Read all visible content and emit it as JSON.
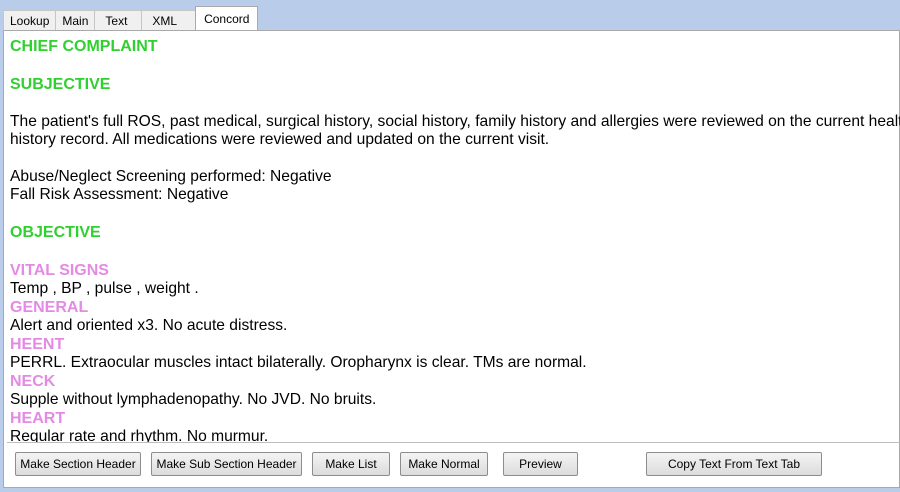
{
  "tabs": [
    "Lookup",
    "Main",
    "Text",
    "XML",
    "Concord"
  ],
  "active_tab": "Concord",
  "editor": {
    "chief_complaint": "CHIEF COMPLAINT",
    "subjective": "SUBJECTIVE",
    "subjective_line1": "The patient's full ROS, past medical, surgical history, social history, family history and allergies were reviewed on the current health",
    "subjective_line2": "history record.  All medications were reviewed and updated on the current visit.",
    "abuse_screening": "Abuse/Neglect Screening performed:  Negative",
    "fall_risk": "Fall Risk Assessment:  Negative",
    "objective": "OBJECTIVE",
    "vital_signs": "VITAL SIGNS",
    "vital_signs_text": "Temp , BP , pulse , weight .",
    "general": "GENERAL",
    "general_text": "Alert and oriented x3.  No acute distress.",
    "heent": "HEENT",
    "heent_text": "PERRL.  Extraocular muscles intact bilaterally.  Oropharynx is clear.  TMs are normal.",
    "neck": "NECK",
    "neck_text": "Supple without lymphadenopathy.  No JVD.  No bruits.",
    "heart": "HEART",
    "heart_text": "Regular rate and rhythm.  No murmur."
  },
  "buttons": {
    "make_section_header": "Make Section Header",
    "make_sub_section_header": "Make Sub Section Header",
    "make_list": "Make List",
    "make_normal": "Make Normal",
    "preview": "Preview",
    "copy_text": "Copy Text From Text Tab"
  },
  "colors": {
    "section_header": "#2fd02f",
    "sub_section_header": "#e48ae4",
    "window_background": "#b9cdea"
  }
}
